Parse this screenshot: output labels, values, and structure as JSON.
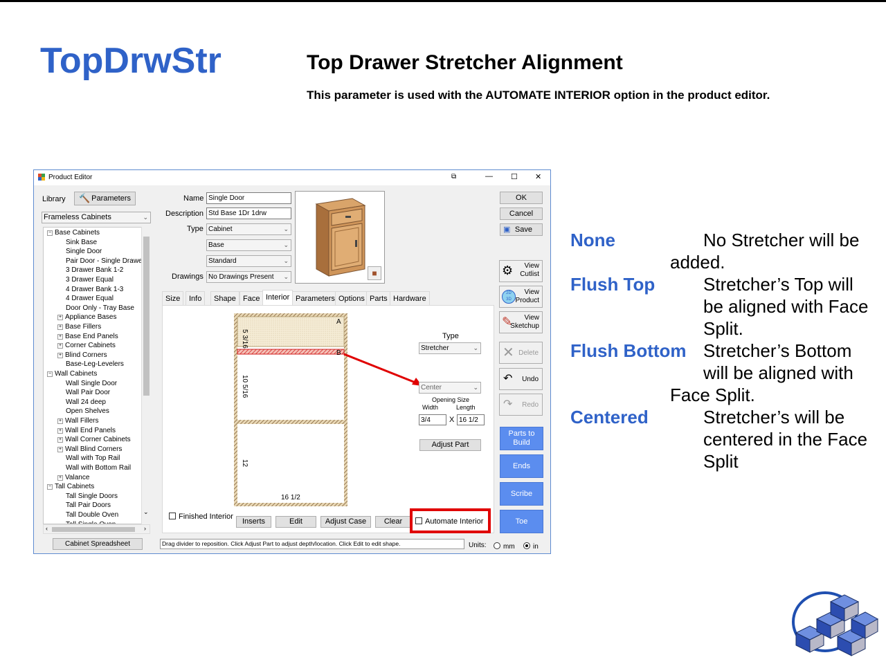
{
  "slide": {
    "title": "TopDrwStr",
    "heading": "Top Drawer Stretcher Alignment",
    "subheading": "This parameter is used with the AUTOMATE INTERIOR option in the product editor."
  },
  "window": {
    "title": "Product Editor",
    "controls": {
      "minimize": "—",
      "maximize": "☐",
      "close": "✕"
    }
  },
  "library": {
    "label": "Library",
    "parameters_button": "Parameters",
    "catalog": "Frameless Cabinets",
    "tree": [
      {
        "label": "Base Cabinets",
        "level": 0,
        "expander": "−"
      },
      {
        "label": "Sink Base",
        "level": 1
      },
      {
        "label": "Single Door",
        "level": 1
      },
      {
        "label": "Pair Door - Single Drawer",
        "level": 1
      },
      {
        "label": "3 Drawer Bank 1-2",
        "level": 1
      },
      {
        "label": "3 Drawer Equal",
        "level": 1
      },
      {
        "label": "4 Drawer Bank 1-3",
        "level": 1
      },
      {
        "label": "4 Drawer Equal",
        "level": 1
      },
      {
        "label": "Door Only - Tray Base",
        "level": 1
      },
      {
        "label": "Appliance Bases",
        "level": 1,
        "expander": "+"
      },
      {
        "label": "Base Fillers",
        "level": 1,
        "expander": "+"
      },
      {
        "label": "Base End Panels",
        "level": 1,
        "expander": "+"
      },
      {
        "label": "Corner Cabinets",
        "level": 1,
        "expander": "+"
      },
      {
        "label": "Blind Corners",
        "level": 1,
        "expander": "+"
      },
      {
        "label": "Base-Leg-Levelers",
        "level": 1
      },
      {
        "label": "Wall Cabinets",
        "level": 0,
        "expander": "−"
      },
      {
        "label": "Wall Single Door",
        "level": 1
      },
      {
        "label": "Wall Pair Door",
        "level": 1
      },
      {
        "label": "Wall 24 deep",
        "level": 1
      },
      {
        "label": "Open Shelves",
        "level": 1
      },
      {
        "label": "Wall Fillers",
        "level": 1,
        "expander": "+"
      },
      {
        "label": "Wall End Panels",
        "level": 1,
        "expander": "+"
      },
      {
        "label": "Wall Corner Cabinets",
        "level": 1,
        "expander": "+"
      },
      {
        "label": "Wall Blind Corners",
        "level": 1,
        "expander": "+"
      },
      {
        "label": "Wall with Top Rail",
        "level": 1
      },
      {
        "label": "Wall with Bottom Rail",
        "level": 1
      },
      {
        "label": "Valance",
        "level": 1,
        "expander": "+"
      },
      {
        "label": "Tall Cabinets",
        "level": 0,
        "expander": "−"
      },
      {
        "label": "Tall Single Doors",
        "level": 1
      },
      {
        "label": "Tall Pair Doors",
        "level": 1
      },
      {
        "label": "Tall Double Oven",
        "level": 1
      },
      {
        "label": "Tall Single Oven",
        "level": 1
      }
    ],
    "spreadsheet_button": "Cabinet Spreadsheet"
  },
  "form": {
    "name_label": "Name",
    "name_value": "Single Door",
    "description_label": "Description",
    "description_value": "Std Base 1Dr 1drw",
    "type_label": "Type",
    "type_value": "Cabinet",
    "subtype_value": "Base",
    "style_value": "Standard",
    "drawings_label": "Drawings",
    "drawings_value": "No Drawings Present"
  },
  "tabs": [
    "Size",
    "Info",
    "Shape",
    "Face",
    "Interior",
    "Parameters",
    "Options",
    "Parts",
    "Hardware"
  ],
  "active_tab": "Interior",
  "interior": {
    "dim_top": "5 3/16",
    "dim_mid": "10 5/16",
    "dim_bottom": "12",
    "dim_width": "16 1/2",
    "marker_a": "A",
    "marker_b": "B",
    "type_label": "Type",
    "type_value": "Stretcher",
    "alignment_value": "Center",
    "opening_size_label": "Opening Size",
    "width_label": "Width",
    "length_label": "Length",
    "width_value": "3/4",
    "times": "X",
    "length_value": "16 1/2",
    "adjust_part_button": "Adjust Part",
    "finished_interior": "Finished Interior",
    "inserts_button": "Inserts",
    "edit_button": "Edit",
    "adjust_case_button": "Adjust Case",
    "clear_button": "Clear",
    "automate_interior": "Automate Interior"
  },
  "right_buttons": {
    "ok": "OK",
    "cancel": "Cancel",
    "save": "Save",
    "view_cutlist": "View\nCutlist",
    "view_product": "View\nProduct",
    "view_sketchup": "View\nSketchup",
    "delete": "Delete",
    "undo": "Undo",
    "redo": "Redo",
    "parts_to_build": "Parts to\nBuild",
    "ends": "Ends",
    "scribe": "Scribe",
    "toe": "Toe"
  },
  "status": {
    "hint": "Drag divider to reposition. Click Adjust Part to adjust depth/location. Click Edit to edit shape.",
    "units_label": "Units:",
    "mm": "mm",
    "in": "in",
    "selected_unit": "in"
  },
  "legend": [
    {
      "term": "None",
      "text": "No Stretcher will be",
      "cont": [
        "added."
      ]
    },
    {
      "term": "Flush Top",
      "text": "Stretcher’s Top will",
      "cont2": [
        "be aligned with Face",
        "Split."
      ]
    },
    {
      "term": "Flush Bottom",
      "text": "Stretcher’s Bottom",
      "cont2": [
        "will be aligned with"
      ],
      "cont": [
        "Face Split."
      ]
    },
    {
      "term": "Centered",
      "text": "Stretcher’s will be",
      "cont2": [
        "centered in the Face",
        "Split"
      ]
    }
  ],
  "colors": {
    "title_blue": "#2f62c8",
    "button_blue": "#5b8def",
    "highlight_red": "#e00000"
  }
}
